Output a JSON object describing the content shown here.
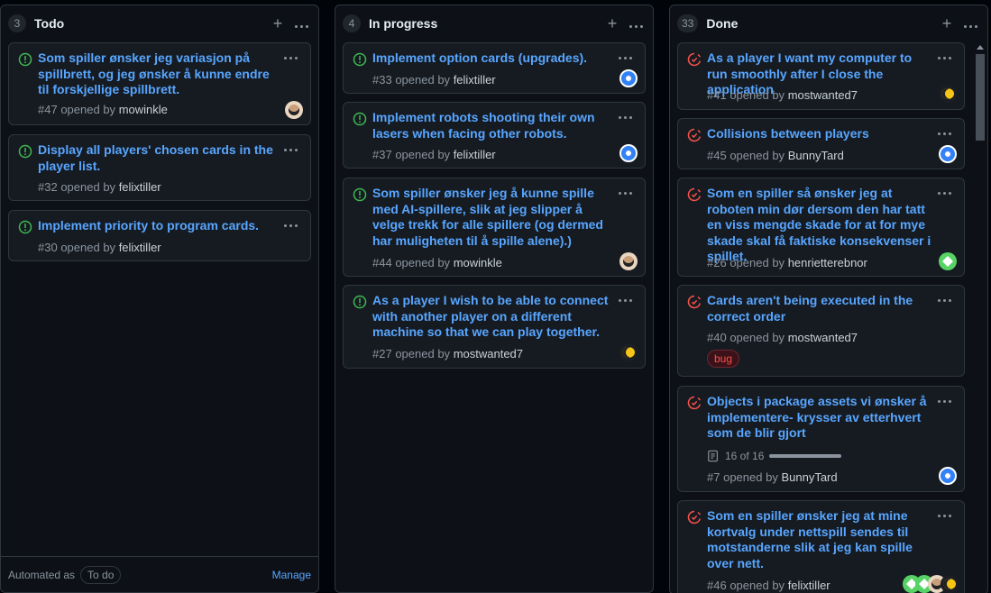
{
  "columns": [
    {
      "count": "3",
      "name": "Todo",
      "cards": [
        {
          "title": "Som spiller ønsker jeg variasjon på spillbrett, og jeg ønsker å kunne endre til forskjellige spillbrett.",
          "number": "#47",
          "opened_by": "opened by",
          "user": "mowinkle"
        },
        {
          "title": "Display all players' chosen cards in the player list.",
          "number": "#32",
          "opened_by": "opened by",
          "user": "felixtiller"
        },
        {
          "title": "Implement priority to program cards.",
          "number": "#30",
          "opened_by": "opened by",
          "user": "felixtiller"
        }
      ],
      "footer": {
        "automated_label": "Automated as",
        "automation": "To do",
        "manage": "Manage"
      }
    },
    {
      "count": "4",
      "name": "In progress",
      "cards": [
        {
          "title": "Implement option cards (upgrades).",
          "number": "#33",
          "opened_by": "opened by",
          "user": "felixtiller"
        },
        {
          "title": "Implement robots shooting their own lasers when facing other robots.",
          "number": "#37",
          "opened_by": "opened by",
          "user": "felixtiller"
        },
        {
          "title": "Som spiller ønsker jeg å kunne spille med AI-spillere, slik at jeg slipper å velge trekk for alle spillere (og dermed har muligheten til å spille alene).)",
          "number": "#44",
          "opened_by": "opened by",
          "user": "mowinkle"
        },
        {
          "title": "As a player I wish to be able to connect with another player on a different machine so that we can play together.",
          "number": "#27",
          "opened_by": "opened by",
          "user": "mostwanted7"
        }
      ]
    },
    {
      "count": "33",
      "name": "Done",
      "cards": [
        {
          "title": "As a player I want my computer to run smoothly after I close the application",
          "number": "#41",
          "opened_by": "opened by",
          "user": "mostwanted7"
        },
        {
          "title": "Collisions between players",
          "number": "#45",
          "opened_by": "opened by",
          "user": "BunnyTard"
        },
        {
          "title": "Som en spiller så ønsker jeg at roboten min dør dersom den har tatt en viss mengde skade for at for mye skade skal få faktiske konsekvenser i spillet.",
          "number": "#26",
          "opened_by": "opened by",
          "user": "henrietterebnor"
        },
        {
          "title": "Cards aren't being executed in the correct order",
          "number": "#40",
          "opened_by": "opened by",
          "user": "mostwanted7",
          "label": "bug"
        },
        {
          "title": "Objects i package assets vi ønsker å implementere- krysser av etterhvert som de blir gjort",
          "number": "#7",
          "opened_by": "opened by",
          "user": "BunnyTard",
          "progress_text": "16 of 16",
          "progress": 1.0
        },
        {
          "title": "Som en spiller ønsker jeg at mine kortvalg under nettspill sendes til motstanderne slik at jeg kan spille over nett.",
          "number": "#46",
          "opened_by": "opened by",
          "user": "felixtiller"
        }
      ]
    }
  ],
  "icons": {
    "add": "plus-icon",
    "menu": "kebab-icon",
    "open_issue": "issue-opened-icon",
    "closed_issue": "issue-closed-icon",
    "checklist": "checklist-icon"
  },
  "colors": {
    "open": "#3fb950",
    "closed": "#f85149",
    "link": "#58a6ff",
    "bg": "#0d1117",
    "card": "#161b22"
  }
}
